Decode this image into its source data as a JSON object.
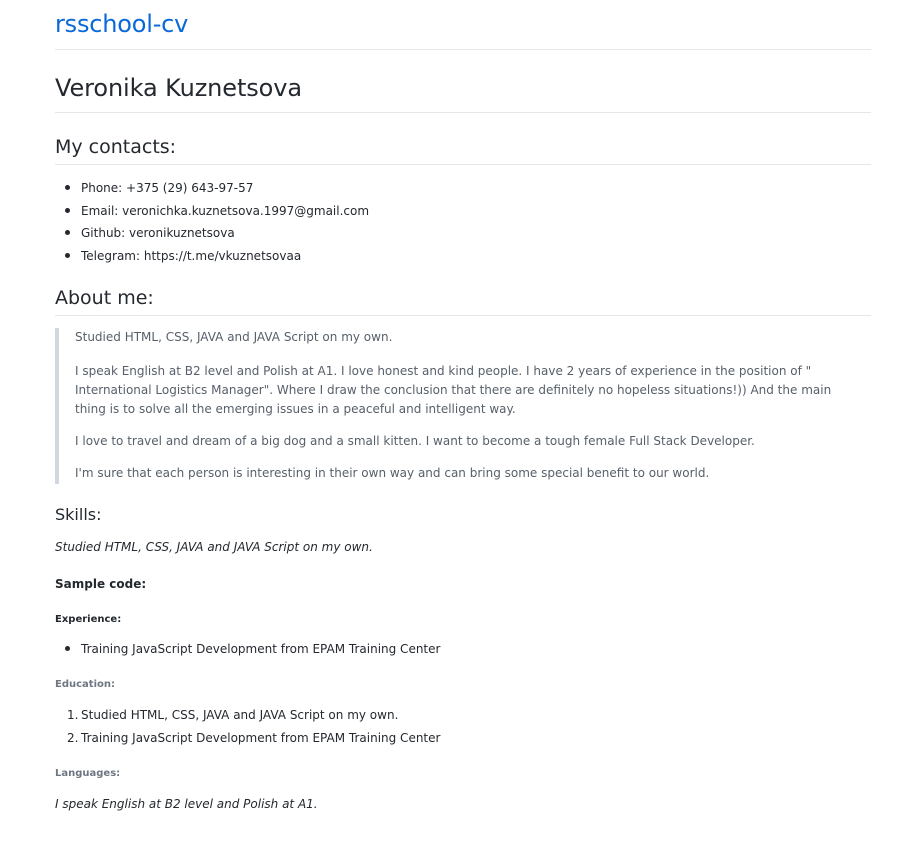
{
  "site": {
    "title": "rsschool-cv"
  },
  "cv": {
    "name": "Veronika Kuznetsova",
    "contacts_heading": "My contacts:",
    "contacts": [
      "Phone: +375 (29) 643-97-57",
      "Email: veronichka.kuznetsova.1997@gmail.com",
      "Github: veronikuznetsova",
      "Telegram: https://t.me/vkuznetsovaa"
    ],
    "about_heading": "About me:",
    "about": [
      "Studied HTML, CSS, JAVA and JAVA Script on my own.",
      "I speak English at B2 level and Polish at A1. I love honest and kind people. I have 2 years of experience in the position of \" International Logistics Manager\". Where I draw the conclusion that there are definitely no hopeless situations!)) And the main thing is to solve all the emerging issues in a peaceful and intelligent way.",
      "I love to travel and dream of a big dog and a small kitten. I want to become a tough female Full Stack Developer.",
      "I'm sure that each person is interesting in their own way and can bring some special benefit to our world."
    ],
    "skills_heading": "Skills:",
    "skills_text": "Studied HTML, CSS, JAVA and JAVA Script on my own.",
    "sample_code_heading": "Sample code:",
    "experience_heading": "Experience:",
    "experience": [
      "Training JavaScript Development from EPAM Training Center"
    ],
    "education_heading": "Education:",
    "education": [
      "Studied HTML, CSS, JAVA and JAVA Script on my own.",
      "Training JavaScript Development from EPAM Training Center"
    ],
    "languages_heading": "Languages:",
    "languages_text": "I speak English at B2 level and Polish at A1."
  },
  "colors": {
    "link": "#0969da",
    "text": "#24292f",
    "muted": "#57606a",
    "rule": "#e5e7eb",
    "quote_border": "#d0d7de"
  }
}
